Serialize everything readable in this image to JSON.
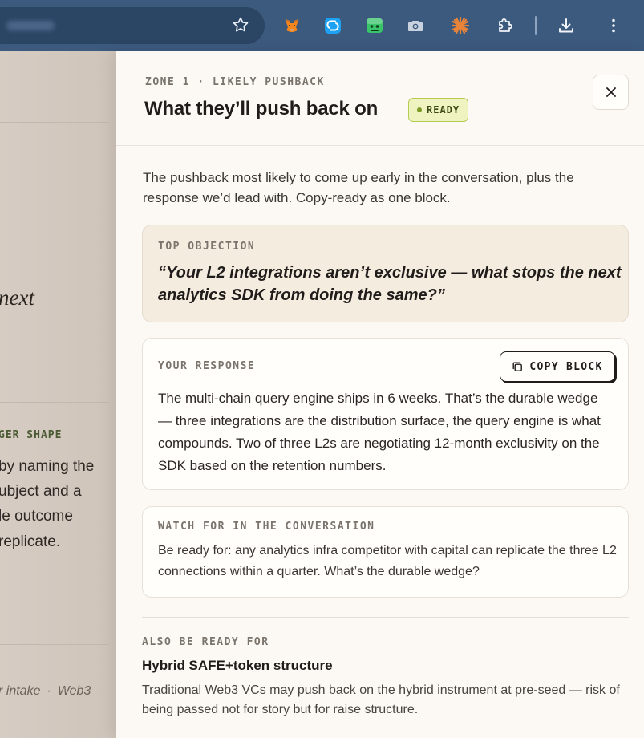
{
  "browser": {
    "icons": [
      "bookmark-star-icon",
      "metamask-fox-icon",
      "blue-swirl-extension-icon",
      "green-robot-extension-icon",
      "camera-extension-icon",
      "orange-burst-extension-icon",
      "puzzle-extensions-icon",
      "download-icon",
      "kebab-menu-icon"
    ]
  },
  "background_page": {
    "italic_word": "next",
    "mono_label": "GER SHAPE",
    "lines": [
      "by naming the",
      "ubject and a",
      "le outcome",
      "replicate."
    ],
    "footer_left": "r intake",
    "footer_sep": "·",
    "footer_right": "Web3"
  },
  "panel": {
    "eyebrow": "ZONE 1 · LIKELY PUSHBACK",
    "title": "What they’ll push back on",
    "badge": "READY",
    "intro": "The pushback most likely to come up early in the conversation, plus the response we’d lead with. Copy-ready as one block.",
    "objection": {
      "label": "TOP OBJECTION",
      "quote": "“Your L2 integrations aren’t exclusive — what stops the next analytics SDK from doing the same?”"
    },
    "response": {
      "label": "YOUR RESPONSE",
      "copy_label": "COPY BLOCK",
      "text": "The multi-chain query engine ships in 6 weeks. That’s the durable wedge — three integrations are the distribution surface, the query engine is what compounds. Two of three L2s are negotiating 12-month exclusivity on the SDK based on the retention numbers."
    },
    "watch": {
      "label": "WATCH FOR IN THE CONVERSATION",
      "text": "Be ready for: any analytics infra competitor with capital can replicate the three L2 connections within a quarter. What’s the durable wedge?"
    },
    "also": {
      "label": "ALSO BE READY FOR",
      "title": "Hybrid SAFE+token structure",
      "text": "Traditional Web3 VCs may push back on the hybrid instrument at pre-seed — risk of being passed not for story but for raise structure."
    }
  },
  "colors": {
    "toolbar": "#3c5a7e",
    "panel_bg": "#fcf9f4",
    "objection_bg": "#f5ece0",
    "badge_bg": "#eef3bf",
    "badge_border": "#b5cc52"
  }
}
